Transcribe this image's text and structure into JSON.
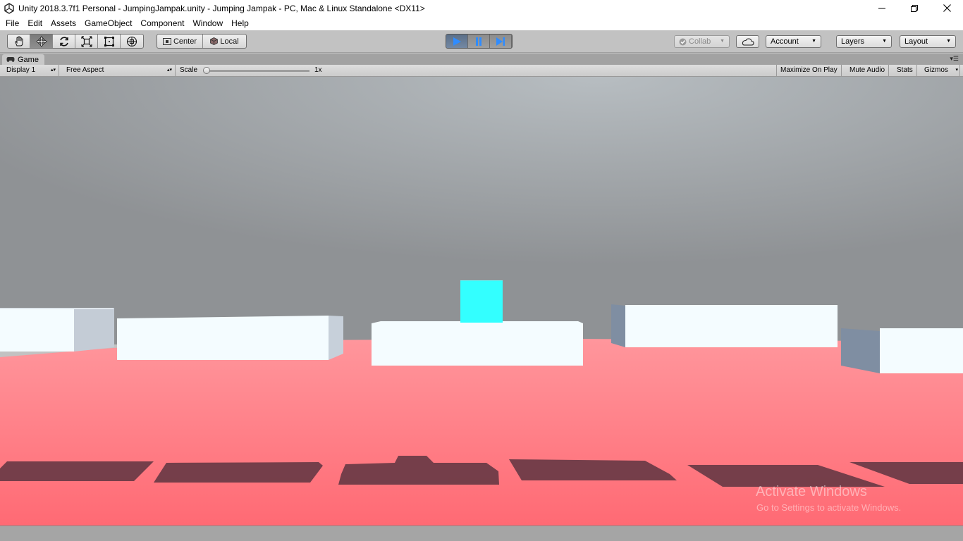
{
  "window": {
    "title": "Unity 2018.3.7f1 Personal - JumpingJampak.unity - Jumping Jampak - PC, Mac & Linux Standalone <DX11>",
    "app_icon": "unity-logo-icon",
    "controls": [
      "minimize-icon",
      "restore-icon",
      "close-icon"
    ]
  },
  "menu": [
    "File",
    "Edit",
    "Assets",
    "GameObject",
    "Component",
    "Window",
    "Help"
  ],
  "toolbar": {
    "tools": [
      {
        "name": "hand-tool",
        "icon": "hand-icon",
        "active": false
      },
      {
        "name": "move-tool",
        "icon": "move-arrows-icon",
        "active": true
      },
      {
        "name": "rotate-tool",
        "icon": "rotate-icon",
        "active": false
      },
      {
        "name": "scale-tool",
        "icon": "scale-icon",
        "active": false
      },
      {
        "name": "rect-tool",
        "icon": "rect-transform-icon",
        "active": false
      },
      {
        "name": "transform-tool",
        "icon": "transform-icon",
        "active": false
      }
    ],
    "pivot_label": "Center",
    "space_label": "Local",
    "play": {
      "playing": true,
      "paused": false
    },
    "collab_label": "Collab",
    "account_label": "Account",
    "layers_label": "Layers",
    "layout_label": "Layout"
  },
  "game_tab": {
    "label": "Game",
    "icon": "game-controller-icon"
  },
  "game_view": {
    "display_label": "Display 1",
    "aspect_label": "Free Aspect",
    "scale_label": "Scale",
    "scale_value": "1x",
    "maximize_label": "Maximize On Play",
    "mute_label": "Mute Audio",
    "stats_label": "Stats",
    "gizmos_label": "Gizmos"
  },
  "scene_colors": {
    "sky": "#a5abb0",
    "floor": "#ff7a82",
    "platform": "#f4fcff",
    "player": "#33ffff",
    "shadow": "#6b3a46"
  },
  "watermark": {
    "line1": "Activate Windows",
    "line2": "Go to Settings to activate Windows."
  }
}
